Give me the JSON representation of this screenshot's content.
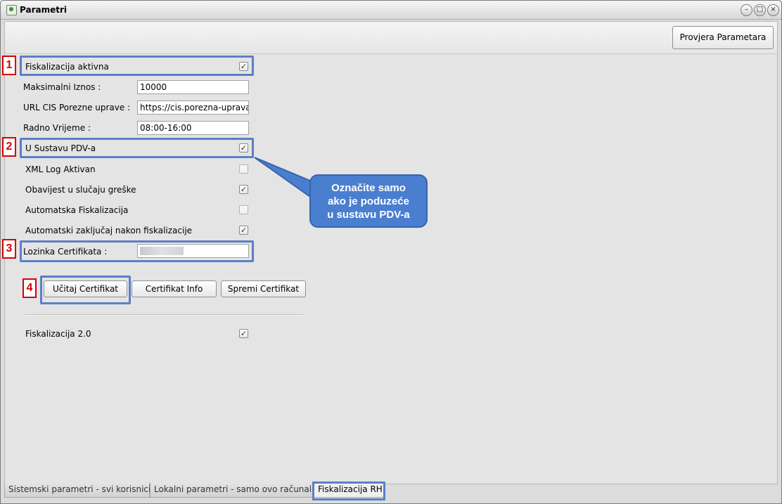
{
  "window": {
    "title": "Parametri",
    "minimize_glyph": "–",
    "maximize_glyph": "□",
    "close_glyph": "×"
  },
  "toolbar": {
    "check_button": "Provjera Parametara"
  },
  "form": {
    "fiscal_active": {
      "label": "Fiskalizacija aktivna",
      "checked": true
    },
    "max_amount": {
      "label": "Maksimalni Iznos :",
      "value": "10000"
    },
    "cis_url": {
      "label": "URL CIS Porezne uprave :",
      "value": "https://cis.porezna-uprava."
    },
    "work_time": {
      "label": "Radno Vrijeme :",
      "value": "08:00-16:00"
    },
    "in_vat": {
      "label": "U Sustavu PDV-a",
      "checked": true
    },
    "xml_log": {
      "label": "XML Log Aktivan",
      "checked": false
    },
    "error_notice": {
      "label": "Obavijest u slučaju greške",
      "checked": true
    },
    "auto_fiscal": {
      "label": "Automatska Fiskalizacija",
      "checked": false
    },
    "auto_lock": {
      "label": "Automatski zaključaj nakon fiskalizacije",
      "checked": true
    },
    "cert_password": {
      "label": "Lozinka Certifikata :"
    },
    "fiscal_2": {
      "label": "Fiskalizacija 2.0",
      "checked": true
    }
  },
  "cert_buttons": {
    "load": "Učitaj Certifikat",
    "info": "Certifikat Info",
    "save": "Spremi Certifikat"
  },
  "annotations": {
    "markers": [
      "1",
      "2",
      "3",
      "4"
    ],
    "callout_lines": [
      "Označite samo",
      "ako je poduzeće",
      "u sustavu PDV-a"
    ]
  },
  "check_glyph": "✓",
  "tabs": [
    {
      "label": "Sistemski parametri - svi korisnici",
      "active": false
    },
    {
      "label": "Lokalni parametri - samo ovo računalo",
      "active": false
    },
    {
      "label": "Fiskalizacija RH",
      "active": true
    }
  ],
  "colors": {
    "highlight": "#5b7fc8",
    "marker": "#d40000",
    "callout": "#4a7fd0"
  }
}
